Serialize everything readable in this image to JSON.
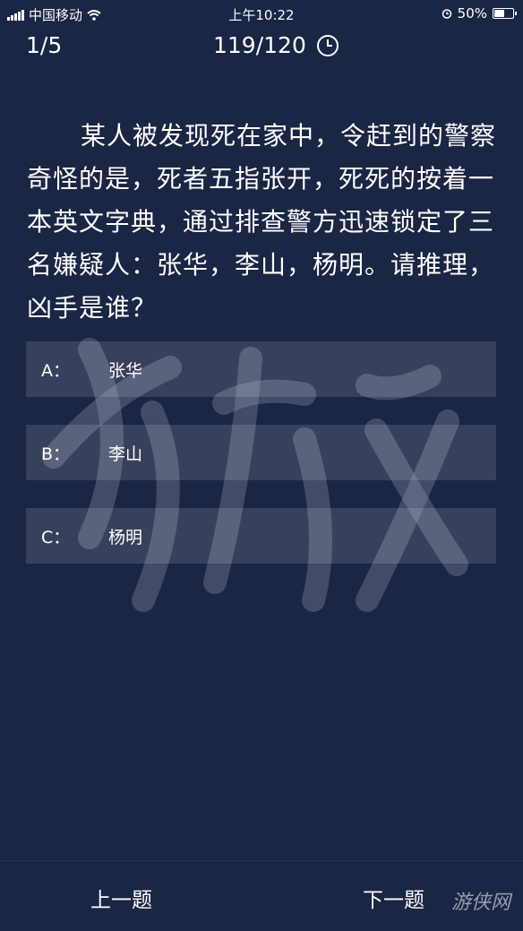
{
  "status_bar": {
    "carrier": "中国移动",
    "time": "上午10:22",
    "battery": "50%"
  },
  "quiz": {
    "progress": "1/5",
    "timer": "119/120"
  },
  "question": {
    "text": "某人被发现死在家中，令赶到的警察奇怪的是，死者五指张开，死死的按着一本英文字典，通过排查警方迅速锁定了三名嫌疑人：张华，李山，杨明。请推理，凶手是谁？"
  },
  "options": [
    {
      "letter": "A：",
      "text": "张华"
    },
    {
      "letter": "B：",
      "text": "李山"
    },
    {
      "letter": "C：",
      "text": "杨明"
    }
  ],
  "footer": {
    "prev_label": "上一题",
    "next_label": "下一题",
    "logo_text": "游侠网"
  },
  "colors": {
    "background": "#1b2544",
    "option_bg": "rgba(255,255,255,0.13)",
    "text": "#ffffff"
  }
}
